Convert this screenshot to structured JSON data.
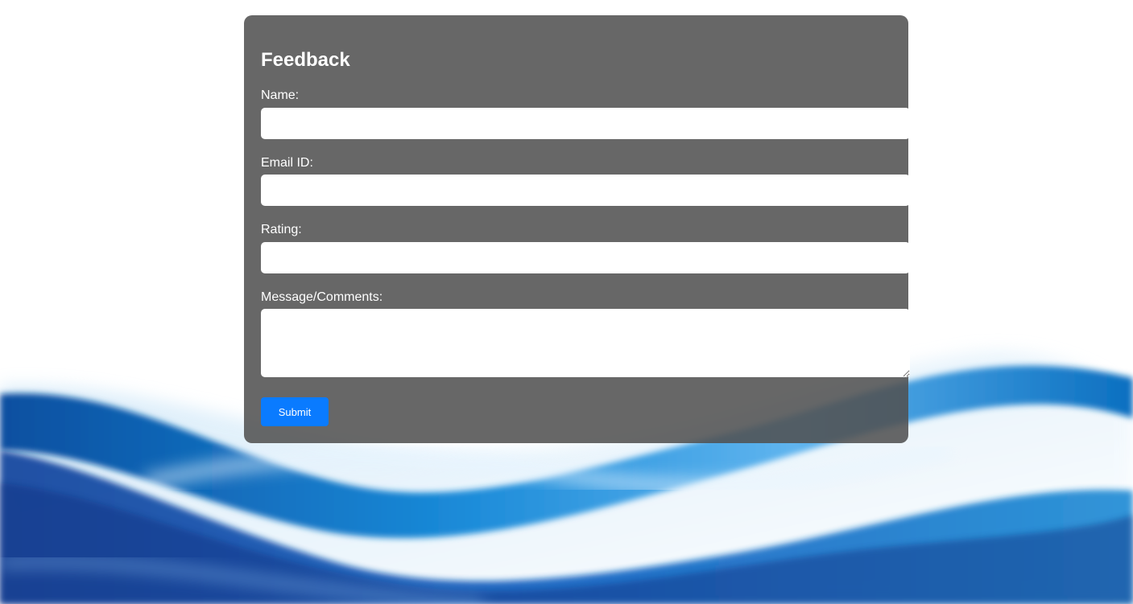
{
  "form": {
    "title": "Feedback",
    "name_label": "Name:",
    "name_value": "",
    "email_label": "Email ID:",
    "email_value": "",
    "rating_label": "Rating:",
    "rating_value": "",
    "message_label": "Message/Comments:",
    "message_value": "",
    "submit_label": "Submit"
  },
  "colors": {
    "panel": "#555555",
    "submit_button": "#0a7bff",
    "wave_blue": "#0a5fb0"
  }
}
